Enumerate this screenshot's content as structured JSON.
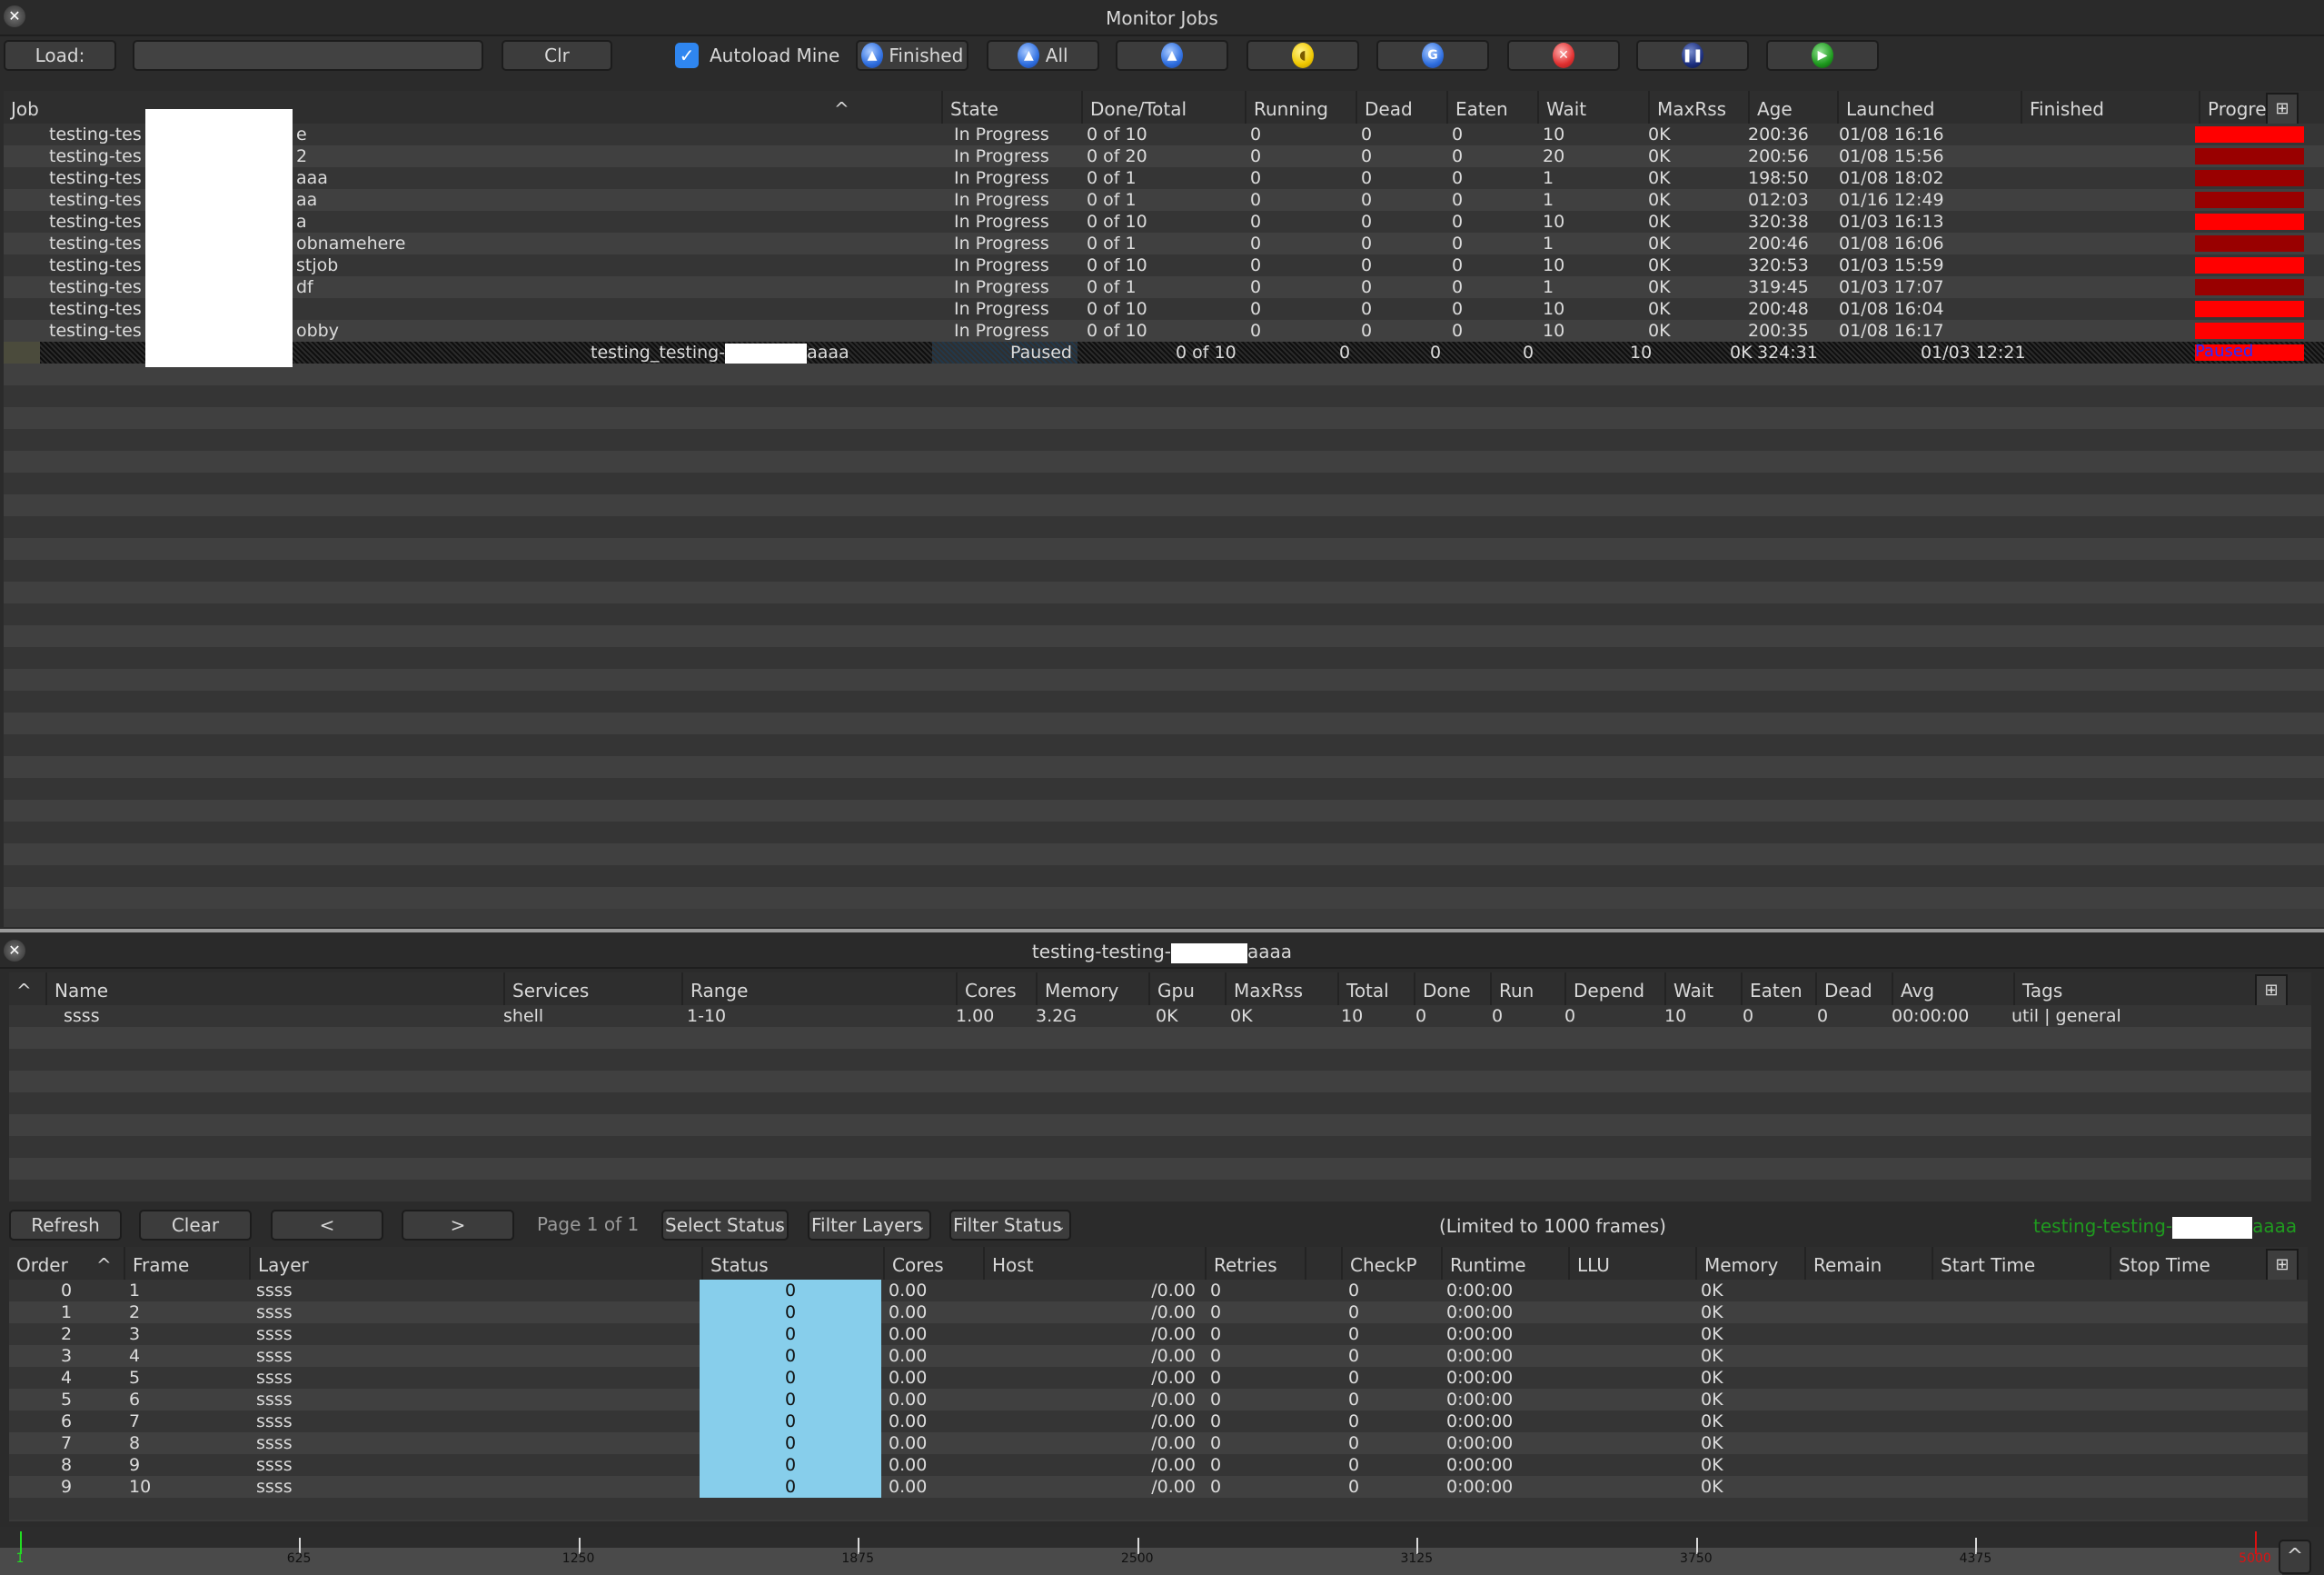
{
  "window": {
    "title": "Monitor Jobs"
  },
  "toolbar": {
    "load_label": "Load:",
    "load_value": "",
    "clr_label": "Clr",
    "autoload_label": "Autoload Mine",
    "autoload_checked": true,
    "finished_label": "Finished",
    "all_label": "All",
    "icon_buttons": [
      "unmonitor-icon",
      "eat-icon",
      "retry-icon",
      "kill-icon",
      "pause-icon",
      "unpause-icon"
    ]
  },
  "jobs_table": {
    "headers": [
      "Job",
      "State",
      "Done/Total",
      "Running",
      "Dead",
      "Eaten",
      "Wait",
      "MaxRss",
      "Age",
      "Launched",
      "Finished",
      "Progre:"
    ],
    "sort_indicator": "^",
    "rows": [
      {
        "job": "testing-tes",
        "suffix": "e",
        "state": "In Progress",
        "done_total": "0 of 10",
        "running": "0",
        "dead": "0",
        "eaten": "0",
        "wait": "10",
        "maxrss": "0K",
        "age": "200:36",
        "launched": "01/08 16:16",
        "finished": "",
        "progress_color": "#ff0000"
      },
      {
        "job": "testing-tes",
        "suffix": "2",
        "state": "In Progress",
        "done_total": "0 of 20",
        "running": "0",
        "dead": "0",
        "eaten": "0",
        "wait": "20",
        "maxrss": "0K",
        "age": "200:56",
        "launched": "01/08 15:56",
        "finished": "",
        "progress_color": "#990000"
      },
      {
        "job": "testing-tes",
        "suffix": "aaa",
        "state": "In Progress",
        "done_total": "0 of 1",
        "running": "0",
        "dead": "0",
        "eaten": "0",
        "wait": "1",
        "maxrss": "0K",
        "age": "198:50",
        "launched": "01/08 18:02",
        "finished": "",
        "progress_color": "#990000"
      },
      {
        "job": "testing-tes",
        "suffix": "aa",
        "state": "In Progress",
        "done_total": "0 of 1",
        "running": "0",
        "dead": "0",
        "eaten": "0",
        "wait": "1",
        "maxrss": "0K",
        "age": "012:03",
        "launched": "01/16 12:49",
        "finished": "",
        "progress_color": "#990000"
      },
      {
        "job": "testing-tes",
        "suffix": "a",
        "state": "In Progress",
        "done_total": "0 of 10",
        "running": "0",
        "dead": "0",
        "eaten": "0",
        "wait": "10",
        "maxrss": "0K",
        "age": "320:38",
        "launched": "01/03 16:13",
        "finished": "",
        "progress_color": "#ff0000"
      },
      {
        "job": "testing-tes",
        "suffix": "obnamehere",
        "state": "In Progress",
        "done_total": "0 of 1",
        "running": "0",
        "dead": "0",
        "eaten": "0",
        "wait": "1",
        "maxrss": "0K",
        "age": "200:46",
        "launched": "01/08 16:06",
        "finished": "",
        "progress_color": "#990000"
      },
      {
        "job": "testing-tes",
        "suffix": "stjob",
        "state": "In Progress",
        "done_total": "0 of 10",
        "running": "0",
        "dead": "0",
        "eaten": "0",
        "wait": "10",
        "maxrss": "0K",
        "age": "320:53",
        "launched": "01/03 15:59",
        "finished": "",
        "progress_color": "#ff0000"
      },
      {
        "job": "testing-tes",
        "suffix": "df",
        "state": "In Progress",
        "done_total": "0 of 1",
        "running": "0",
        "dead": "0",
        "eaten": "0",
        "wait": "1",
        "maxrss": "0K",
        "age": "319:45",
        "launched": "01/03 17:07",
        "finished": "",
        "progress_color": "#990000"
      },
      {
        "job": "testing-tes",
        "suffix": "",
        "state": "In Progress",
        "done_total": "0 of 10",
        "running": "0",
        "dead": "0",
        "eaten": "0",
        "wait": "10",
        "maxrss": "0K",
        "age": "200:48",
        "launched": "01/08 16:04",
        "finished": "",
        "progress_color": "#ff0000"
      },
      {
        "job": "testing-tes",
        "suffix": "obby",
        "state": "In Progress",
        "done_total": "0 of 10",
        "running": "0",
        "dead": "0",
        "eaten": "0",
        "wait": "10",
        "maxrss": "0K",
        "age": "200:35",
        "launched": "01/08 16:17",
        "finished": "",
        "progress_color": "#ff0000"
      }
    ],
    "selected_row": {
      "job_prefix": "testing_testing-",
      "job_suffix": "aaaa",
      "state": "Paused",
      "done_total": "0 of 10",
      "running": "0",
      "dead": "0",
      "eaten": "0",
      "wait": "10",
      "maxrss": "0K",
      "age": "324:31",
      "launched": "01/03 12:21",
      "finished": "",
      "progress_label": "Paused",
      "progress_color": "#ff0000",
      "progress_label_color": "#2a2aff"
    }
  },
  "layers_panel": {
    "title_prefix": "testing-testing-",
    "title_suffix": "aaaa",
    "headers": [
      "Name",
      "Services",
      "Range",
      "Cores",
      "Memory",
      "Gpu",
      "MaxRss",
      "Total",
      "Done",
      "Run",
      "Depend",
      "Wait",
      "Eaten",
      "Dead",
      "Avg",
      "Tags"
    ],
    "sort_indicator": "^",
    "rows": [
      {
        "name": "ssss",
        "services": "shell",
        "range": "1-10",
        "cores": "1.00",
        "memory": "3.2G",
        "gpu": "0K",
        "maxrss": "0K",
        "total": "10",
        "done": "0",
        "run": "0",
        "depend": "0",
        "wait": "10",
        "eaten": "0",
        "dead": "0",
        "avg": "00:00:00",
        "tags": "util | general"
      }
    ]
  },
  "frames_toolbar": {
    "refresh_label": "Refresh",
    "clear_label": "Clear",
    "prev_label": "<",
    "next_label": ">",
    "page_label": "Page 1 of 1",
    "select_status_label": "Select Status",
    "filter_layers_label": "Filter Layers",
    "filter_status_label": "Filter Status",
    "limit_label": "(Limited to 1000 frames)",
    "job_name_prefix": "testing-testing-",
    "job_name_suffix": "aaaa",
    "job_name_color": "#1f9a1f"
  },
  "frames_table": {
    "headers": [
      "Order",
      "Frame",
      "Layer",
      "Status",
      "Cores",
      "Host",
      "Retries",
      "CheckP",
      "Runtime",
      "LLU",
      "Memory",
      "Remain",
      "Start Time",
      "Stop Time"
    ],
    "sort_indicator": "^",
    "status_color": "#87ceeb",
    "rows": [
      {
        "order": "0",
        "frame": "1",
        "layer": "ssss",
        "status": "0",
        "cores": "0.00",
        "host": "/0.00",
        "retries": "0",
        "checkp": "0",
        "runtime": "0:00:00",
        "llu": "",
        "memory": "0K",
        "remain": "",
        "start": "",
        "stop": ""
      },
      {
        "order": "1",
        "frame": "2",
        "layer": "ssss",
        "status": "0",
        "cores": "0.00",
        "host": "/0.00",
        "retries": "0",
        "checkp": "0",
        "runtime": "0:00:00",
        "llu": "",
        "memory": "0K",
        "remain": "",
        "start": "",
        "stop": ""
      },
      {
        "order": "2",
        "frame": "3",
        "layer": "ssss",
        "status": "0",
        "cores": "0.00",
        "host": "/0.00",
        "retries": "0",
        "checkp": "0",
        "runtime": "0:00:00",
        "llu": "",
        "memory": "0K",
        "remain": "",
        "start": "",
        "stop": ""
      },
      {
        "order": "3",
        "frame": "4",
        "layer": "ssss",
        "status": "0",
        "cores": "0.00",
        "host": "/0.00",
        "retries": "0",
        "checkp": "0",
        "runtime": "0:00:00",
        "llu": "",
        "memory": "0K",
        "remain": "",
        "start": "",
        "stop": ""
      },
      {
        "order": "4",
        "frame": "5",
        "layer": "ssss",
        "status": "0",
        "cores": "0.00",
        "host": "/0.00",
        "retries": "0",
        "checkp": "0",
        "runtime": "0:00:00",
        "llu": "",
        "memory": "0K",
        "remain": "",
        "start": "",
        "stop": ""
      },
      {
        "order": "5",
        "frame": "6",
        "layer": "ssss",
        "status": "0",
        "cores": "0.00",
        "host": "/0.00",
        "retries": "0",
        "checkp": "0",
        "runtime": "0:00:00",
        "llu": "",
        "memory": "0K",
        "remain": "",
        "start": "",
        "stop": ""
      },
      {
        "order": "6",
        "frame": "7",
        "layer": "ssss",
        "status": "0",
        "cores": "0.00",
        "host": "/0.00",
        "retries": "0",
        "checkp": "0",
        "runtime": "0:00:00",
        "llu": "",
        "memory": "0K",
        "remain": "",
        "start": "",
        "stop": ""
      },
      {
        "order": "7",
        "frame": "8",
        "layer": "ssss",
        "status": "0",
        "cores": "0.00",
        "host": "/0.00",
        "retries": "0",
        "checkp": "0",
        "runtime": "0:00:00",
        "llu": "",
        "memory": "0K",
        "remain": "",
        "start": "",
        "stop": ""
      },
      {
        "order": "8",
        "frame": "9",
        "layer": "ssss",
        "status": "0",
        "cores": "0.00",
        "host": "/0.00",
        "retries": "0",
        "checkp": "0",
        "runtime": "0:00:00",
        "llu": "",
        "memory": "0K",
        "remain": "",
        "start": "",
        "stop": ""
      },
      {
        "order": "9",
        "frame": "10",
        "layer": "ssss",
        "status": "0",
        "cores": "0.00",
        "host": "/0.00",
        "retries": "0",
        "checkp": "0",
        "runtime": "0:00:00",
        "llu": "",
        "memory": "0K",
        "remain": "",
        "start": "",
        "stop": ""
      }
    ]
  },
  "timeline": {
    "min": 1,
    "max": 5000,
    "ticks": [
      "1",
      "625",
      "1250",
      "1875",
      "2500",
      "3125",
      "3750",
      "4375",
      "5000"
    ],
    "start_marker_color": "#22dd22",
    "end_marker_color": "#dd1111",
    "collapse_label": "^"
  }
}
